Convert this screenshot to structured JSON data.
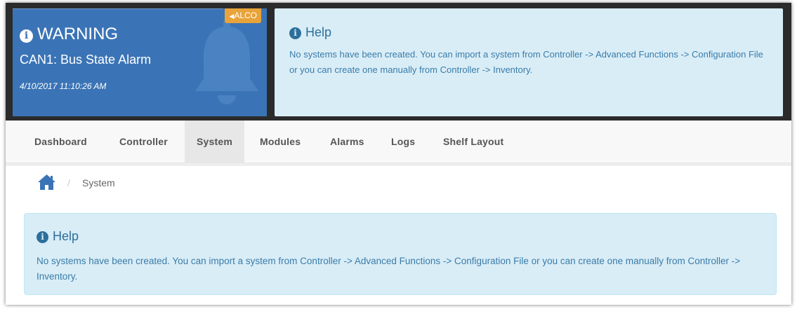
{
  "alarm": {
    "tag": "ALCO",
    "level": "WARNING",
    "message": "CAN1: Bus State Alarm",
    "timestamp": "4/10/2017 11:10:26 AM"
  },
  "help_banner": {
    "title": "Help",
    "text": "No systems have been created. You can import a system from Controller -> Advanced Functions -> Configuration File or you can create one manually from Controller -> Inventory."
  },
  "nav": {
    "items": [
      "Dashboard",
      "Controller",
      "System",
      "Modules",
      "Alarms",
      "Logs",
      "Shelf Layout"
    ],
    "active": "System"
  },
  "breadcrumb": {
    "separator": "/",
    "current": "System"
  },
  "help_main": {
    "title": "Help",
    "text": "No systems have been created. You can import a system from Controller -> Advanced Functions -> Configuration File or you can create one manually from Controller -> Inventory."
  },
  "colors": {
    "alarm_bg": "#3b74b6",
    "alco_tag": "#e8a33a",
    "info_bg": "#d9edf7",
    "info_text": "#3a7ca8",
    "navbar_bg": "#f8f8f8"
  },
  "icons": [
    "info-circle-icon",
    "bell-icon",
    "home-icon",
    "caret-left-icon"
  ]
}
